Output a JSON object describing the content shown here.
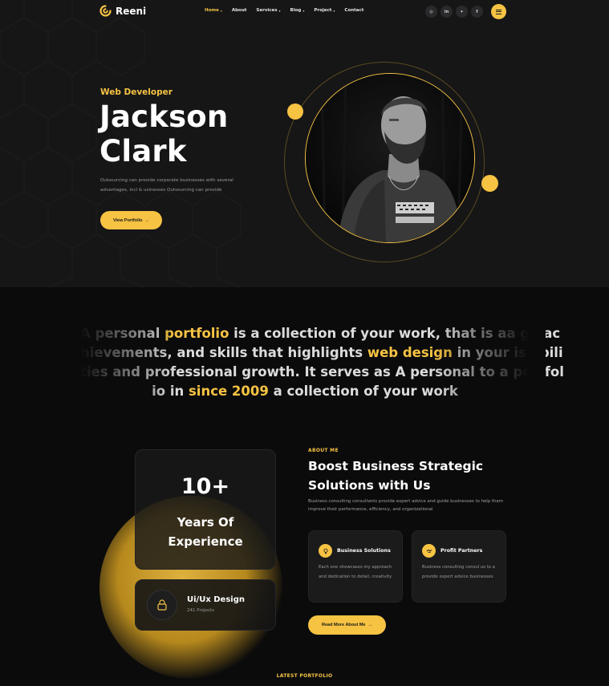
{
  "nav": {
    "logo_text": "Reeni",
    "items": [
      {
        "label": "Home",
        "has_caret": true,
        "active": true
      },
      {
        "label": "About",
        "has_caret": false,
        "active": false
      },
      {
        "label": "Services",
        "has_caret": true,
        "active": false
      },
      {
        "label": "Blog",
        "has_caret": true,
        "active": false
      },
      {
        "label": "Project",
        "has_caret": true,
        "active": false
      },
      {
        "label": "Contact",
        "has_caret": false,
        "active": false
      }
    ],
    "socials": [
      {
        "icon": "instagram-icon",
        "glyph": "◎"
      },
      {
        "icon": "linkedin-icon",
        "glyph": "in"
      },
      {
        "icon": "twitter-icon",
        "glyph": "✦"
      },
      {
        "icon": "facebook-icon",
        "glyph": "f"
      }
    ],
    "menu_icon": "hamburger-icon"
  },
  "hero": {
    "role": "Web Developer",
    "name_line1": "Jackson",
    "name_line2": "Clark",
    "description": "Outsourcing can provide corporate businesses with several advantages, incl & usinesses Outsourcing can provide",
    "cta_label": "View Portfolio",
    "cta_icon": "arrow-right-icon"
  },
  "statement": {
    "line1": [
      {
        "t": "A personal "
      },
      {
        "t": "portfolio",
        "hl": true
      },
      {
        "t": " is a collection of your work, that is aa go ac"
      }
    ],
    "line2": [
      {
        "t": "hievements, and skills that highlights "
      },
      {
        "t": "web design",
        "hl": true
      },
      {
        "t": " in your is abili"
      }
    ],
    "line3": [
      {
        "t": "ties and professional growth. It serves as A personal to a portfol"
      }
    ],
    "line4": [
      {
        "t": "io in "
      },
      {
        "t": "since 2009",
        "hl": true
      },
      {
        "t": " a collection of your work"
      }
    ]
  },
  "experience": {
    "number": "10+",
    "label_line1": "Years Of",
    "label_line2": "Experience"
  },
  "skill_card": {
    "icon": "lock-icon",
    "title": "Ui/Ux Design",
    "subtitle": "241 Projects"
  },
  "about": {
    "tag": "ABOUT ME",
    "title_line1": "Boost Business Strategic",
    "title_line2": "Solutions with Us",
    "description": "Business consulting consultants provide expert advice and guide businesses to help them improve their performance, efficiency, and organizational",
    "features": [
      {
        "title": "Business Solutions",
        "description": "Each one showcases my approach and dedication to detail, creativity"
      },
      {
        "title": "Profit Partners",
        "description": "Business consulting consul us to a provide expert advice businesses"
      }
    ],
    "cta_label": "Read More About Me",
    "cta_icon": "arrow-right-icon"
  },
  "latest": {
    "label": "LATEST PORTFOLIO"
  },
  "colors": {
    "accent": "#f6c343",
    "hero_bg": "#161617",
    "page_bg": "#0b0b0c",
    "card_bg": "#1b1b1c"
  }
}
